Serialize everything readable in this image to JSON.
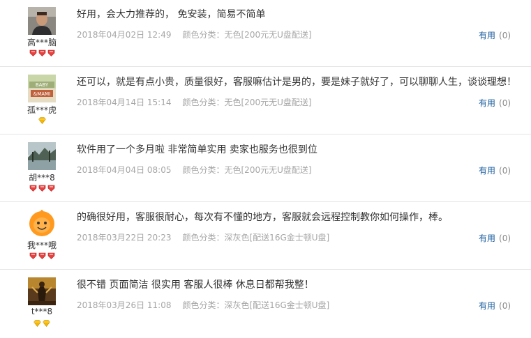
{
  "reviews": [
    {
      "user": "高***脑",
      "avatar_icon": "man-photo-avatar",
      "badge_type": "red-heart",
      "badge_count": 3,
      "text": "好用，会大力推荐的， 免安装，简易不简单",
      "date": "2018年04月02日 12:49",
      "color_label": "颜色分类：",
      "color_value": "无色[200元无U盘配送]",
      "useful_label": "有用",
      "useful_count": "(0)"
    },
    {
      "user": "孤***虎",
      "avatar_icon": "baby-mami-avatar",
      "badge_type": "gold-diamond",
      "badge_count": 1,
      "text": "还可以，就是有点小贵，质量很好，客服嘛估计是男的，要是妹子就好了，可以聊聊人生，谈谈理想！",
      "date": "2018年04月14日 15:14",
      "color_label": "颜色分类：",
      "color_value": "无色[200元无U盘配送]",
      "useful_label": "有用",
      "useful_count": "(0)"
    },
    {
      "user": "胡***8",
      "avatar_icon": "lake-landscape-avatar",
      "badge_type": "red-heart",
      "badge_count": 3,
      "text": "软件用了一个多月啦 非常简单实用 卖家也服务也很到位",
      "date": "2018年04月04日 08:05",
      "color_label": "颜色分类：",
      "color_value": "无色[200元无U盘配送]",
      "useful_label": "有用",
      "useful_count": "(0)"
    },
    {
      "user": "我***哦",
      "avatar_icon": "default-orange-avatar",
      "badge_type": "red-heart",
      "badge_count": 3,
      "text": "的确很好用，客服很耐心，每次有不懂的地方，客服就会远程控制教你如何操作，棒。",
      "date": "2018年03月22日 20:23",
      "color_label": "颜色分类：",
      "color_value": "深灰色[配送16G金士顿U盘]",
      "useful_label": "有用",
      "useful_count": "(0)"
    },
    {
      "user": "t***8",
      "avatar_icon": "warrior-artwork-avatar",
      "badge_type": "gold-diamond",
      "badge_count": 2,
      "text": "很不错 页面简洁 很实用 客服人很棒 休息日都帮我整！",
      "date": "2018年03月26日 11:08",
      "color_label": "颜色分类：",
      "color_value": "深灰色[配送16G金士顿U盘]",
      "useful_label": "有用",
      "useful_count": "(0)"
    }
  ],
  "colors": {
    "useful_link": "#1a5d9e",
    "meta_text": "#a6a6a6",
    "heart_red": "#e8413f",
    "diamond_gold": "#f5b800"
  }
}
